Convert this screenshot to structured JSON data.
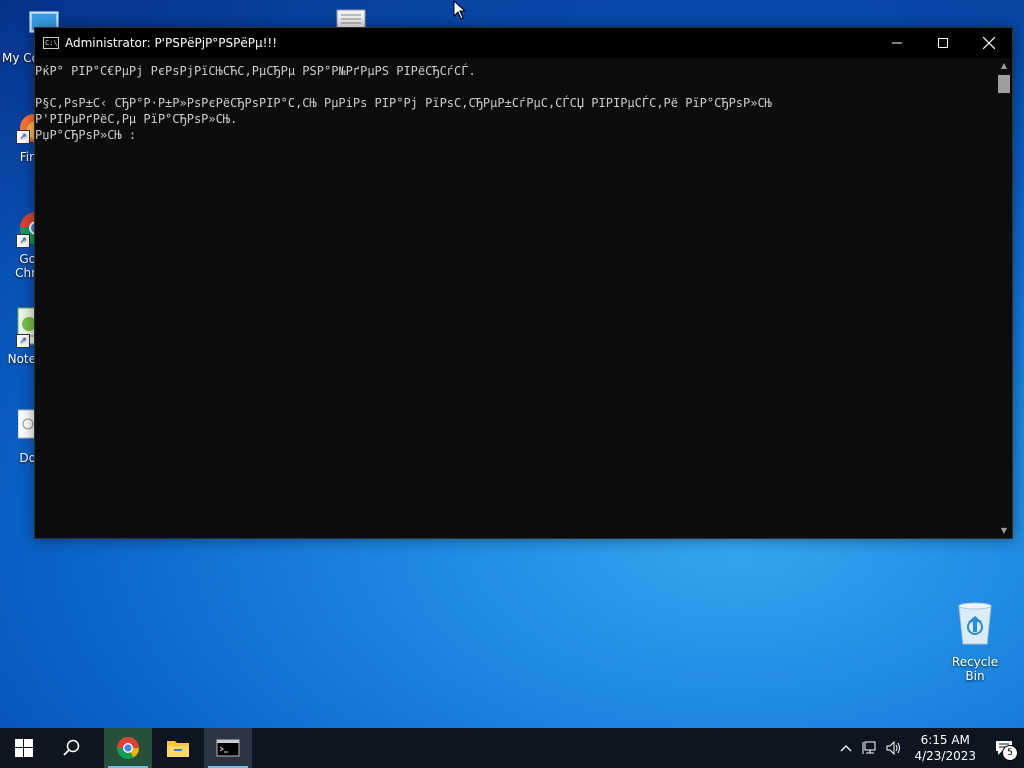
{
  "desktop": {
    "icons": [
      {
        "label": "My Co"
      },
      {
        "label": "Fir"
      },
      {
        "label": "Go\nChr"
      },
      {
        "label": "Note"
      },
      {
        "label": "Do"
      },
      {
        "label": "Recycle Bin"
      }
    ]
  },
  "console": {
    "title": "Administrator: Р'РЅРёРјР°РЅРёРµ!!!",
    "lines": [
      "РќР° РІР°С€РµРј РєРѕРјРїСЊСЋС‚РµСЂРµ РЅР°Р№РґРµРЅ РІРёСЂСѓСЃ.",
      "",
      "Р§С‚РѕР±С‹ СЂР°Р·Р±Р»РѕРєРёСЂРѕРІР°С‚СЊ РµРіРѕ РІР°Рј РїРѕС‚СЂРµР±СѓРµС‚СЃСЏ РІРІРµСЃС‚Рё РїР°СЂРѕР»СЊ",
      "Р'РІРµРґРёС‚Рµ РїР°СЂРѕР»СЊ.",
      "РџР°СЂРѕР»СЊ :"
    ]
  },
  "taskbar": {
    "clock_time": "6:15 AM",
    "clock_date": "4/23/2023",
    "notification_count": "5"
  }
}
